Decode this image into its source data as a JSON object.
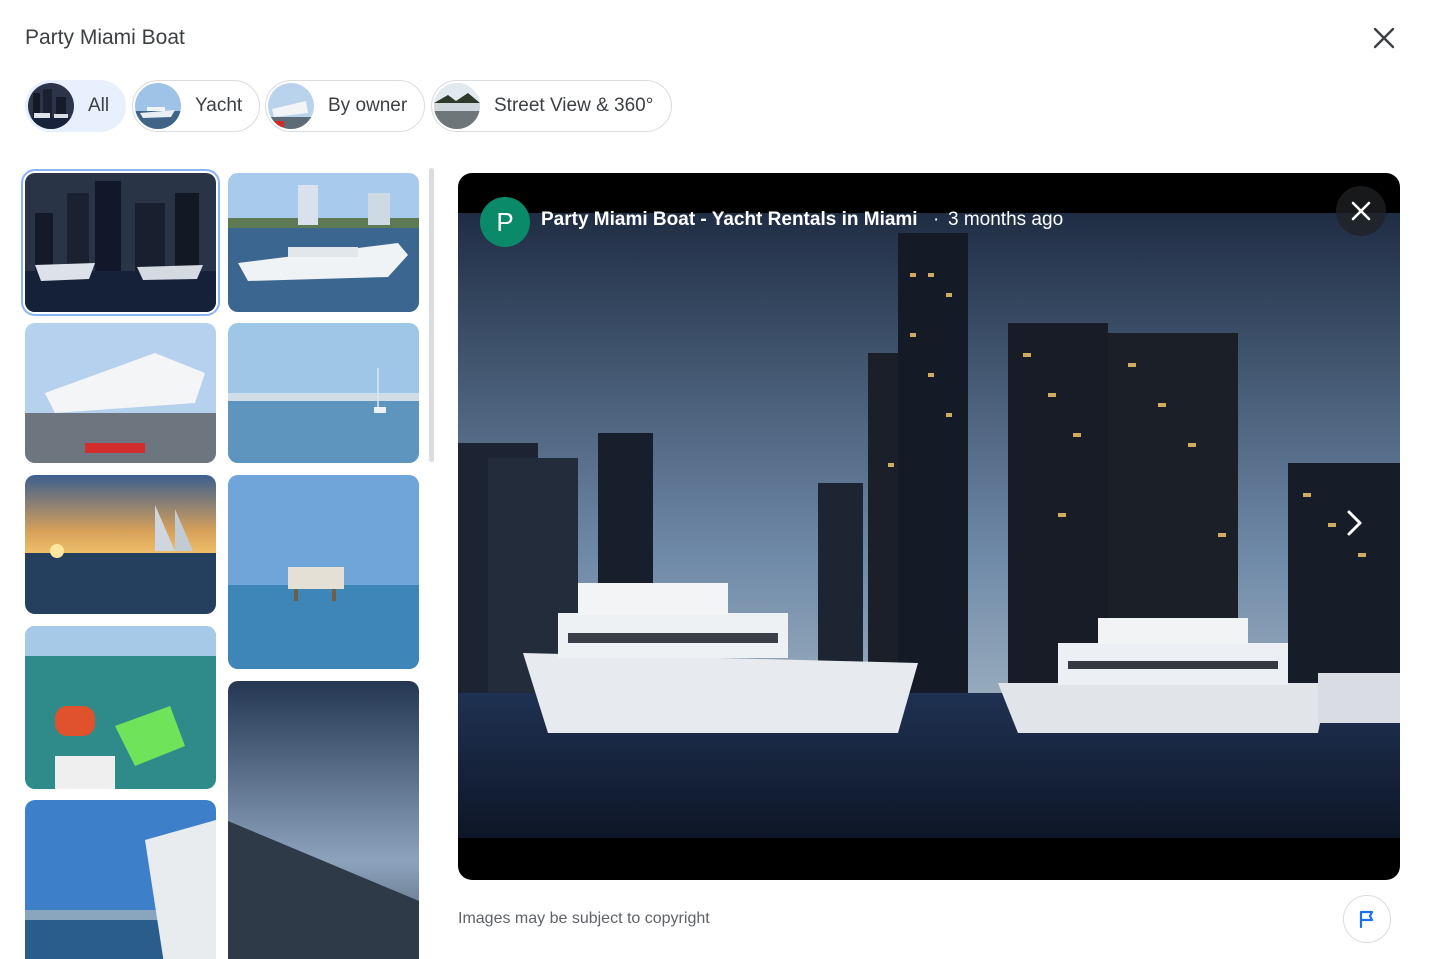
{
  "header": {
    "title": "Party Miami Boat",
    "close_icon": "close-icon"
  },
  "filters": [
    {
      "label": "All",
      "selected": true
    },
    {
      "label": "Yacht",
      "selected": false
    },
    {
      "label": "By owner",
      "selected": false
    },
    {
      "label": "Street View & 360°",
      "selected": false
    }
  ],
  "gallery": {
    "thumbnails": [
      {
        "description": "night skyline with yachts",
        "selected": true
      },
      {
        "description": "white yacht near towers",
        "selected": false
      },
      {
        "description": "yacht deck view",
        "selected": false
      },
      {
        "description": "calm bay with skyline",
        "selected": false
      },
      {
        "description": "sunset with sailboats",
        "selected": false
      },
      {
        "description": "stilt house on water",
        "selected": false
      },
      {
        "description": "people on floats",
        "selected": false
      },
      {
        "description": "tilted skyline dusk",
        "selected": false
      },
      {
        "description": "boat with skyline",
        "selected": false
      }
    ]
  },
  "viewer": {
    "author_initial": "P",
    "author_name": "Party Miami Boat - Yacht Rentals in Miami",
    "separator": "·",
    "posted": "3 months ago",
    "close_icon": "close-icon",
    "next_icon": "chevron-right-icon"
  },
  "footer": {
    "copyright": "Images may be subject to copyright",
    "report_icon": "flag-icon"
  },
  "colors": {
    "accent": "#1a73e8",
    "selected_chip_bg": "#e8f0fe",
    "avatar_bg": "#0b8a6a"
  }
}
